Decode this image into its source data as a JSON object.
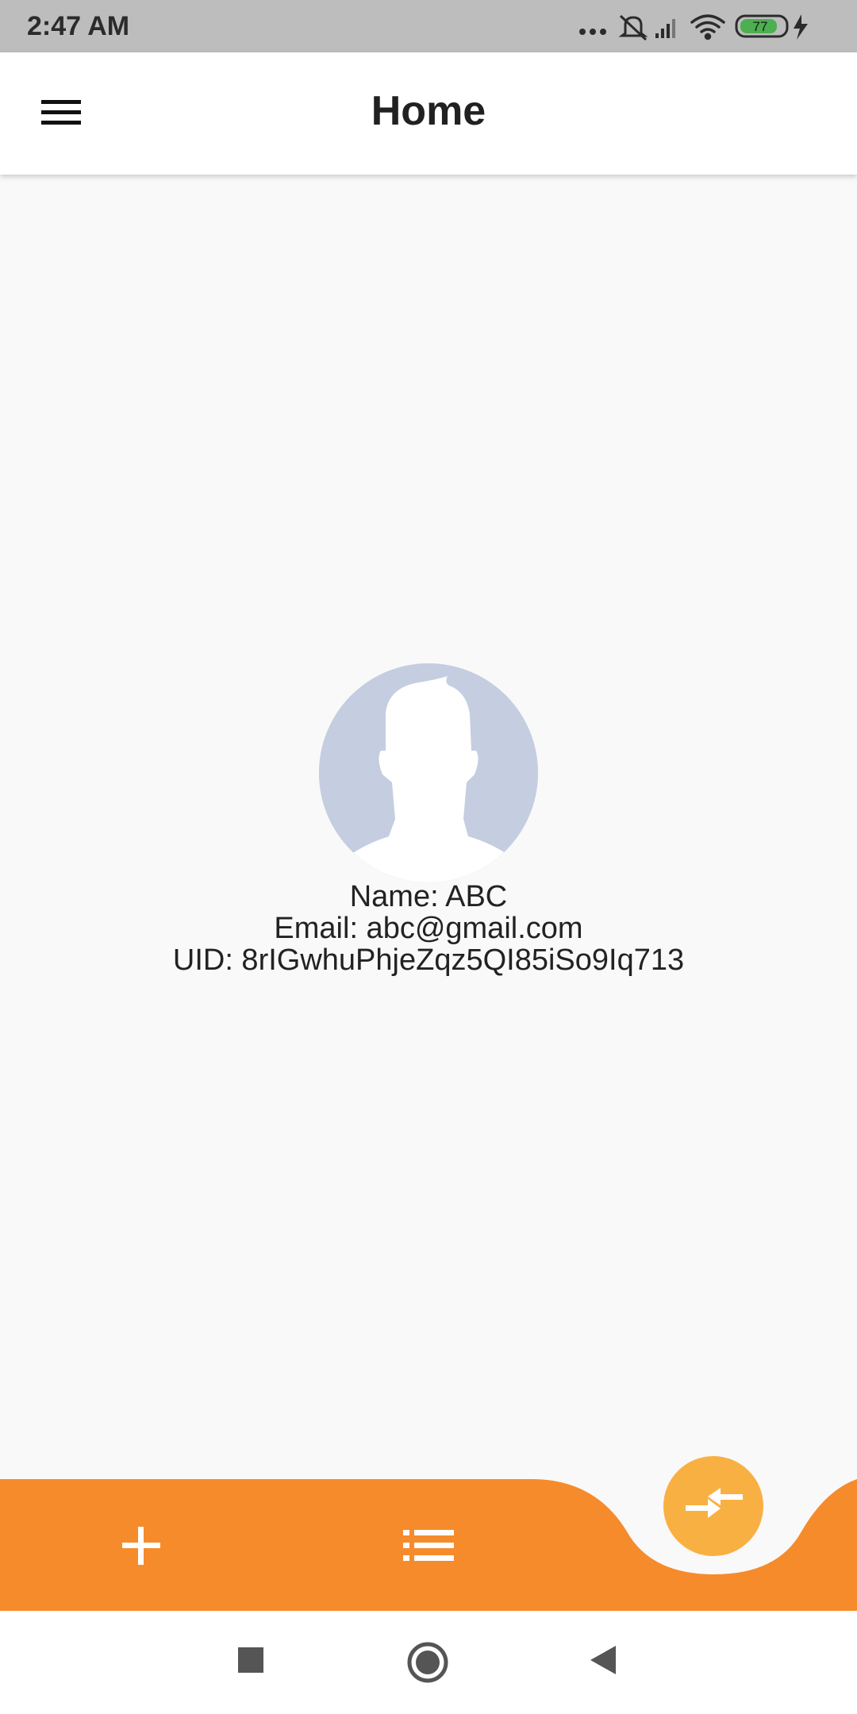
{
  "status_bar": {
    "time": "2:47 AM",
    "battery": "77",
    "icons": [
      "more-dots-icon",
      "notifications-off-icon",
      "signal-icon",
      "wifi-icon",
      "battery-icon",
      "charging-icon"
    ]
  },
  "app_bar": {
    "title": "Home",
    "menu_icon": "menu-icon"
  },
  "profile": {
    "avatar_icon": "default-avatar-icon",
    "name_line": "Name: ABC",
    "email_line": "Email: abc@gmail.com",
    "uid_line": "UID: 8rIGwhuPhjeZqz5QI85iSo9Iq713"
  },
  "bottom_bar": {
    "items": [
      {
        "icon": "add-icon"
      },
      {
        "icon": "list-icon"
      }
    ],
    "fab_icon": "compare-arrows-icon",
    "colors": {
      "bar": "#f68b2c",
      "fab": "#f9b043"
    }
  },
  "nav_bar": {
    "buttons": [
      "recents-square-icon",
      "home-circle-icon",
      "back-triangle-icon"
    ]
  }
}
